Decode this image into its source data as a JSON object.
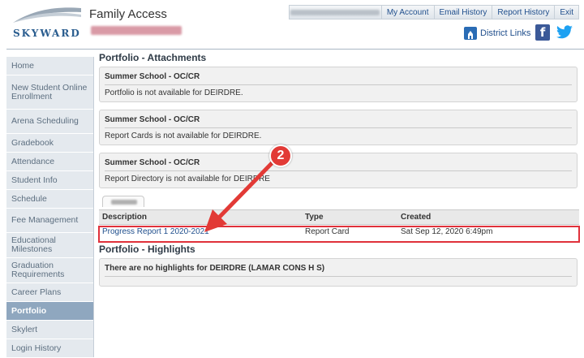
{
  "header": {
    "app_title": "Family Access",
    "logo_text": "SKYWARD",
    "top_links": [
      "My Account",
      "Email History",
      "Report History",
      "Exit"
    ],
    "district_links": "District Links",
    "facebook_glyph": "f"
  },
  "sidebar": {
    "items": [
      {
        "label": "Home"
      },
      {
        "label": "New Student Online Enrollment"
      },
      {
        "label": "Arena Scheduling"
      },
      {
        "label": "Gradebook"
      },
      {
        "label": "Attendance"
      },
      {
        "label": "Student Info"
      },
      {
        "label": "Schedule"
      },
      {
        "label": "Fee Management"
      },
      {
        "label": "Educational Milestones"
      },
      {
        "label": "Graduation Requirements"
      },
      {
        "label": "Career Plans"
      },
      {
        "label": "Portfolio",
        "active": true
      },
      {
        "label": "Skylert"
      },
      {
        "label": "Login History"
      }
    ]
  },
  "main": {
    "attachments_title": "Portfolio - Attachments",
    "panels": [
      {
        "title": "Summer School - OC/CR",
        "message": "Portfolio is not available for DEIRDRE."
      },
      {
        "title": "Summer School - OC/CR",
        "message": "Report Cards is not available for DEIRDRE."
      },
      {
        "title": "Summer School - OC/CR",
        "message": "Report Directory is not available for DEIRDRE"
      }
    ],
    "table": {
      "headers": [
        "Description",
        "Type",
        "Created"
      ],
      "rows": [
        {
          "description": "Progress Report 1 2020-2021",
          "type": "Report Card",
          "created": "Sat Sep 12, 2020 6:49pm"
        }
      ]
    },
    "highlights_title": "Portfolio - Highlights",
    "highlights_message": "There are no highlights for DEIRDRE (LAMAR CONS H S)"
  },
  "annotation": {
    "step": "2",
    "color": "#e23a36"
  },
  "colors": {
    "accent": "#1f4e8c",
    "sidebar_active": "#8fa7bf",
    "highlight_border": "#e0313b"
  }
}
